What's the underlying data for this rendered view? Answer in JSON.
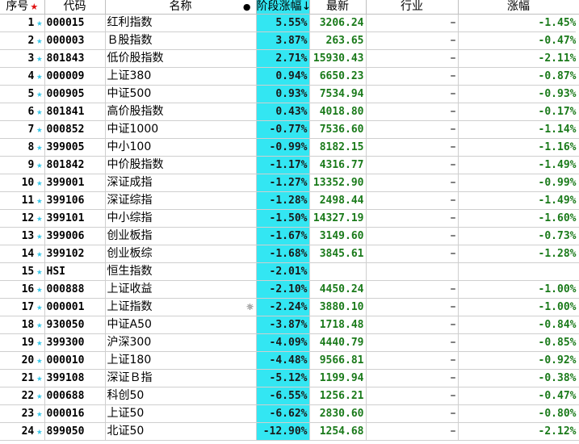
{
  "header": {
    "seq": "序号",
    "seq_mark": "★",
    "code": "代码",
    "name": "名称",
    "name_mark": "●",
    "pct": "阶段涨幅",
    "pct_sort": "↓",
    "last": "最新",
    "industry": "行业",
    "change": "涨幅"
  },
  "colors": {
    "highlight": "#33e6f2",
    "down": "#1a7a1a",
    "star": "#33c6e8",
    "sort_star": "#e01010"
  },
  "rows": [
    {
      "seq": "1",
      "star": "★",
      "code": "000015",
      "name": "红利指数",
      "mark": "",
      "pct": "5.55%",
      "last": "3206.24",
      "industry": "–",
      "change": "-1.45%"
    },
    {
      "seq": "2",
      "star": "★",
      "code": "000003",
      "name": "Ｂ股指数",
      "mark": "",
      "pct": "3.87%",
      "last": "263.65",
      "industry": "–",
      "change": "-0.47%"
    },
    {
      "seq": "3",
      "star": "★",
      "code": "801843",
      "name": "低价股指数",
      "mark": "",
      "pct": "2.71%",
      "last": "15930.43",
      "industry": "–",
      "change": "-2.11%"
    },
    {
      "seq": "4",
      "star": "★",
      "code": "000009",
      "name": "上证380",
      "mark": "",
      "pct": "0.94%",
      "last": "6650.23",
      "industry": "–",
      "change": "-0.87%"
    },
    {
      "seq": "5",
      "star": "★",
      "code": "000905",
      "name": "中证500",
      "mark": "",
      "pct": "0.93%",
      "last": "7534.94",
      "industry": "–",
      "change": "-0.93%"
    },
    {
      "seq": "6",
      "star": "★",
      "code": "801841",
      "name": "高价股指数",
      "mark": "",
      "pct": "0.43%",
      "last": "4018.80",
      "industry": "–",
      "change": "-0.17%"
    },
    {
      "seq": "7",
      "star": "★",
      "code": "000852",
      "name": "中证1000",
      "mark": "",
      "pct": "-0.77%",
      "last": "7536.60",
      "industry": "–",
      "change": "-1.14%"
    },
    {
      "seq": "8",
      "star": "★",
      "code": "399005",
      "name": "中小100",
      "mark": "",
      "pct": "-0.99%",
      "last": "8182.15",
      "industry": "–",
      "change": "-1.16%"
    },
    {
      "seq": "9",
      "star": "★",
      "code": "801842",
      "name": "中价股指数",
      "mark": "",
      "pct": "-1.17%",
      "last": "4316.77",
      "industry": "–",
      "change": "-1.49%"
    },
    {
      "seq": "10",
      "star": "★",
      "code": "399001",
      "name": "深证成指",
      "mark": "",
      "pct": "-1.27%",
      "last": "13352.90",
      "industry": "–",
      "change": "-0.99%"
    },
    {
      "seq": "11",
      "star": "★",
      "code": "399106",
      "name": "深证综指",
      "mark": "",
      "pct": "-1.28%",
      "last": "2498.44",
      "industry": "–",
      "change": "-1.49%"
    },
    {
      "seq": "12",
      "star": "★",
      "code": "399101",
      "name": "中小综指",
      "mark": "",
      "pct": "-1.50%",
      "last": "14327.19",
      "industry": "–",
      "change": "-1.60%"
    },
    {
      "seq": "13",
      "star": "★",
      "code": "399006",
      "name": "创业板指",
      "mark": "",
      "pct": "-1.67%",
      "last": "3149.60",
      "industry": "–",
      "change": "-0.73%"
    },
    {
      "seq": "14",
      "star": "★",
      "code": "399102",
      "name": "创业板综",
      "mark": "",
      "pct": "-1.68%",
      "last": "3845.61",
      "industry": "–",
      "change": "-1.28%"
    },
    {
      "seq": "15",
      "star": "★",
      "code": "HSI",
      "name": "恒生指数",
      "mark": "",
      "pct": "-2.01%",
      "last": "",
      "industry": "",
      "change": ""
    },
    {
      "seq": "16",
      "star": "★",
      "code": "000888",
      "name": "上证收益",
      "mark": "",
      "pct": "-2.10%",
      "last": "4450.24",
      "industry": "–",
      "change": "-1.00%"
    },
    {
      "seq": "17",
      "star": "★",
      "code": "000001",
      "name": "上证指数",
      "mark": "☼",
      "pct": "-2.24%",
      "last": "3880.10",
      "industry": "–",
      "change": "-1.00%"
    },
    {
      "seq": "18",
      "star": "★",
      "code": "930050",
      "name": "中证A50",
      "mark": "",
      "pct": "-3.87%",
      "last": "1718.48",
      "industry": "–",
      "change": "-0.84%"
    },
    {
      "seq": "19",
      "star": "★",
      "code": "399300",
      "name": "沪深300",
      "mark": "",
      "pct": "-4.09%",
      "last": "4440.79",
      "industry": "–",
      "change": "-0.85%"
    },
    {
      "seq": "20",
      "star": "★",
      "code": "000010",
      "name": "上证180",
      "mark": "",
      "pct": "-4.48%",
      "last": "9566.81",
      "industry": "–",
      "change": "-0.92%"
    },
    {
      "seq": "21",
      "star": "★",
      "code": "399108",
      "name": "深证Ｂ指",
      "mark": "",
      "pct": "-5.12%",
      "last": "1199.94",
      "industry": "–",
      "change": "-0.38%"
    },
    {
      "seq": "22",
      "star": "★",
      "code": "000688",
      "name": "科创50",
      "mark": "",
      "pct": "-6.55%",
      "last": "1256.21",
      "industry": "–",
      "change": "-0.47%"
    },
    {
      "seq": "23",
      "star": "★",
      "code": "000016",
      "name": "上证50",
      "mark": "",
      "pct": "-6.62%",
      "last": "2830.60",
      "industry": "–",
      "change": "-0.80%"
    },
    {
      "seq": "24",
      "star": "★",
      "code": "899050",
      "name": "北证50",
      "mark": "",
      "pct": "-12.90%",
      "last": "1254.68",
      "industry": "–",
      "change": "-2.12%"
    }
  ]
}
